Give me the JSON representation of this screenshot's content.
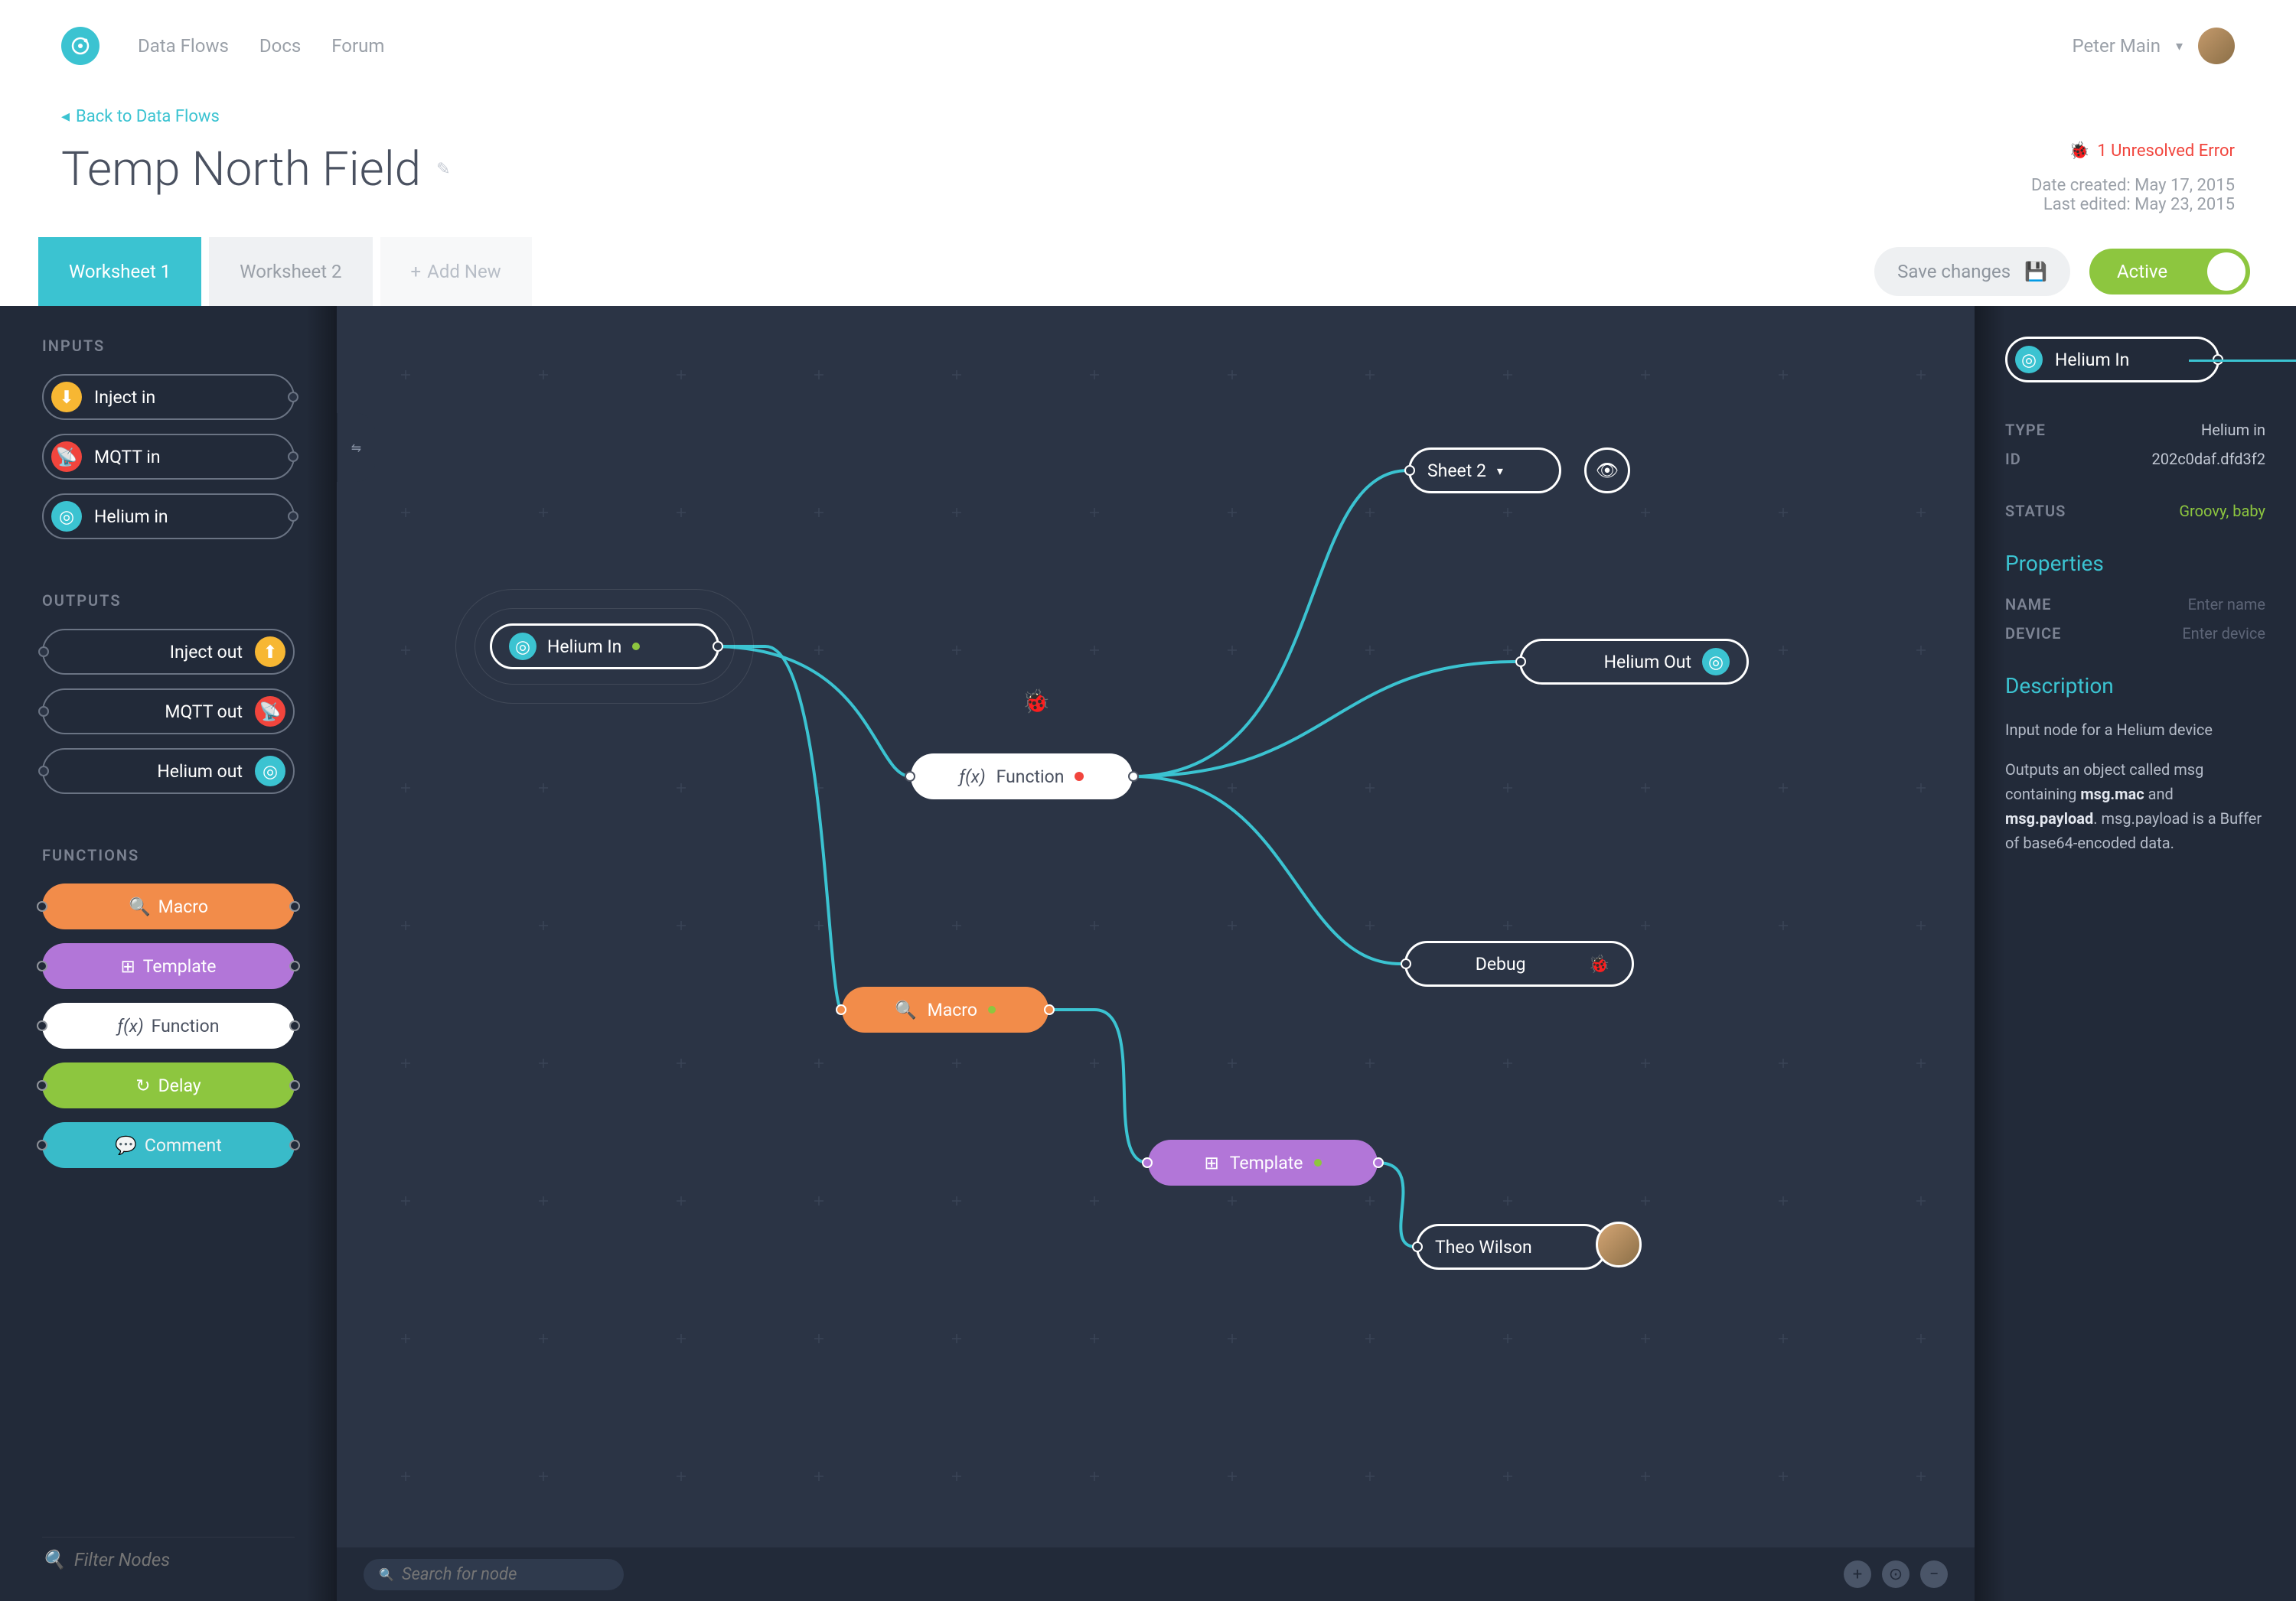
{
  "nav": {
    "links": [
      "Data Flows",
      "Docs",
      "Forum"
    ],
    "user": "Peter Main"
  },
  "header": {
    "back": "Back to Data Flows",
    "title": "Temp North Field",
    "error": "1 Unresolved Error",
    "created": "Date created: May 17, 2015",
    "edited": "Last edited: May 23, 2015"
  },
  "tabs": {
    "t1": "Worksheet 1",
    "t2": "Worksheet 2",
    "add": "Add New",
    "save": "Save changes",
    "active": "Active"
  },
  "palette": {
    "inputs_label": "INPUTS",
    "outputs_label": "OUTPUTS",
    "functions_label": "FUNCTIONS",
    "inputs": [
      {
        "label": "Inject in",
        "color": "c-yellow"
      },
      {
        "label": "MQTT in",
        "color": "c-red"
      },
      {
        "label": "Helium in",
        "color": "c-teal"
      }
    ],
    "outputs": [
      {
        "label": "Inject out",
        "color": "c-yellow"
      },
      {
        "label": "MQTT out",
        "color": "c-red"
      },
      {
        "label": "Helium out",
        "color": "c-teal"
      }
    ],
    "functions": [
      {
        "label": "Macro",
        "cls": "f-orange",
        "icon": "🔍"
      },
      {
        "label": "Template",
        "cls": "f-purple",
        "icon": "⊞"
      },
      {
        "label": "Function",
        "cls": "f-white",
        "icon": "ƒ(x)"
      },
      {
        "label": "Delay",
        "cls": "f-lime",
        "icon": "↻"
      },
      {
        "label": "Comment",
        "cls": "f-aqua",
        "icon": "💬"
      }
    ],
    "filter_placeholder": "Filter Nodes"
  },
  "canvas": {
    "nodes": {
      "heliumIn": "Helium In",
      "function": "Function",
      "macro": "Macro",
      "template": "Template",
      "sheet2": "Sheet 2",
      "heliumOut": "Helium Out",
      "debug": "Debug",
      "theo": "Theo Wilson"
    },
    "search_placeholder": "Search for node"
  },
  "rpanel": {
    "selected": "Helium In",
    "type_k": "TYPE",
    "type_v": "Helium in",
    "id_k": "ID",
    "id_v": "202c0daf.dfd3f2",
    "status_k": "STATUS",
    "status_v": "Groovy, baby",
    "props_title": "Properties",
    "name_k": "NAME",
    "name_v": "Enter name",
    "device_k": "DEVICE",
    "device_v": "Enter device",
    "desc_title": "Description",
    "desc1": "Input node for a Helium device",
    "desc2a": "Outputs an object called msg containing ",
    "desc2b": "msg.mac",
    "desc2c": " and ",
    "desc2d": "msg.payload",
    "desc2e": ". msg.payload is a Buffer of base64-encoded data."
  }
}
